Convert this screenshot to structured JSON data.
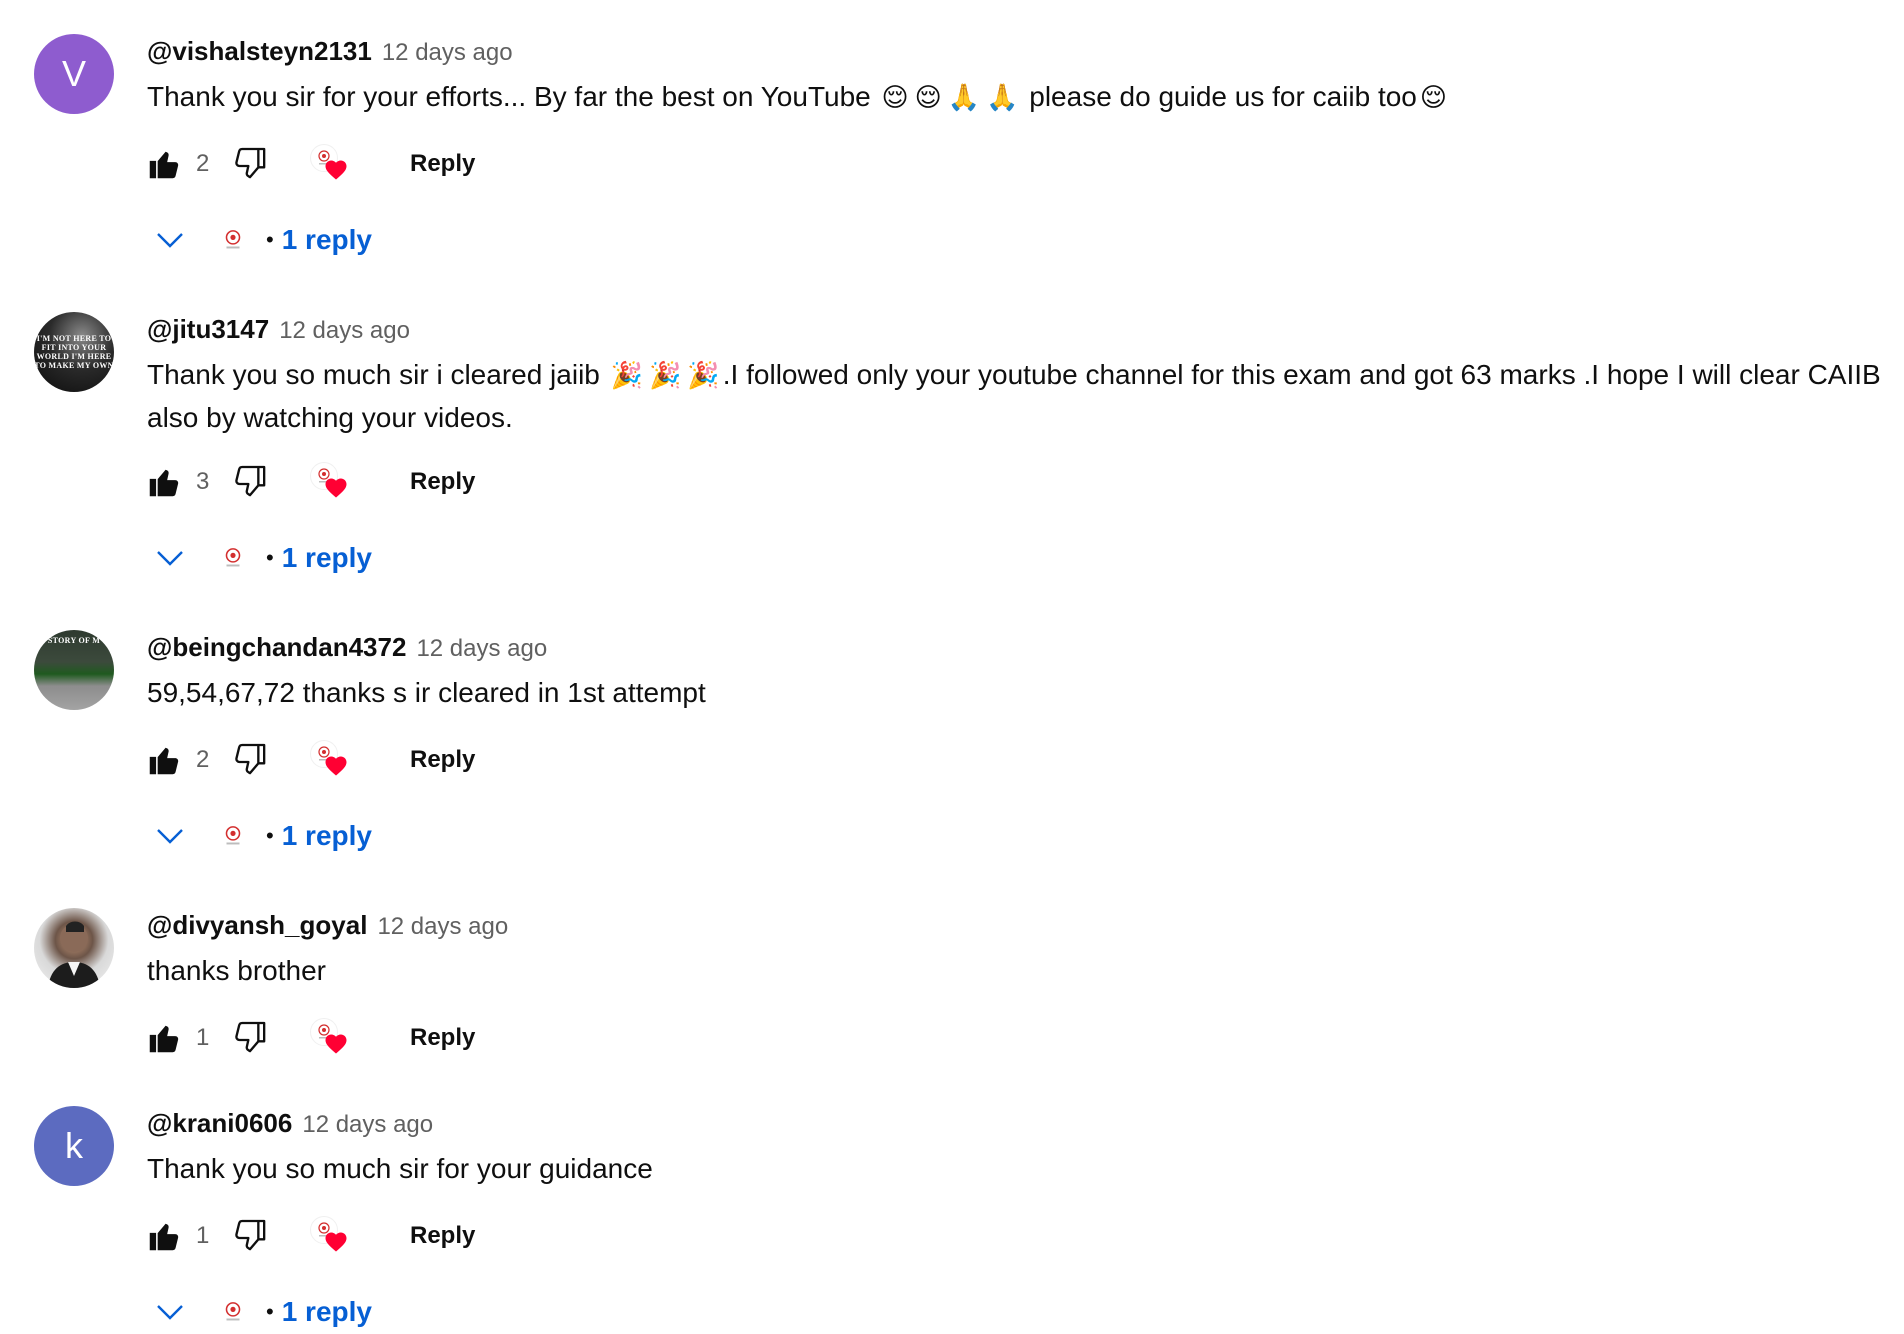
{
  "comments": [
    {
      "author": "@vishalsteyn2131",
      "time": "12 days ago",
      "avatar_letter": "V",
      "text_segments": [
        "Thank you sir for your efforts... By far the best on YouTube ",
        "😌",
        "😌",
        "🙏",
        "🙏",
        " please do guide us for caiib too",
        "😌"
      ],
      "likes": "2",
      "reply_label": "Reply",
      "replies_label": "1 reply"
    },
    {
      "author": "@jitu3147",
      "time": "12 days ago",
      "avatar_text": "I'M NOT HERE TO FIT INTO YOUR WORLD I'M HERE TO MAKE MY OWN",
      "text_segments": [
        "Thank you so much sir i cleared jaiib ",
        "🎉",
        "🎉",
        "🎉",
        ".I followed only your  youtube channel for this exam and got 63 marks .I hope I will clear CAIIB also by watching your videos."
      ],
      "likes": "3",
      "reply_label": "Reply",
      "replies_label": "1 reply"
    },
    {
      "author": "@beingchandan4372",
      "time": "12 days ago",
      "avatar_text": "STORY OF M",
      "text_segments": [
        "59,54,67,72 thanks s ir cleared in 1st attempt"
      ],
      "likes": "2",
      "reply_label": "Reply",
      "replies_label": "1 reply"
    },
    {
      "author": "@divyansh_goyal",
      "time": "12 days ago",
      "text_segments": [
        "thanks brother"
      ],
      "likes": "1",
      "reply_label": "Reply"
    },
    {
      "author": "@krani0606",
      "time": "12 days ago",
      "avatar_letter": "k",
      "text_segments": [
        "Thank you so much sir for your guidance"
      ],
      "likes": "1",
      "reply_label": "Reply",
      "replies_label": "1 reply"
    }
  ],
  "colors": {
    "link_blue": "#065fd4",
    "heart_red": "#ff0033",
    "meta_gray": "#606060"
  },
  "icons": {
    "like": "thumbs-up-filled-icon",
    "dislike": "thumbs-down-outline-icon",
    "heart": "creator-heart-icon",
    "chevron": "chevron-down-icon"
  }
}
